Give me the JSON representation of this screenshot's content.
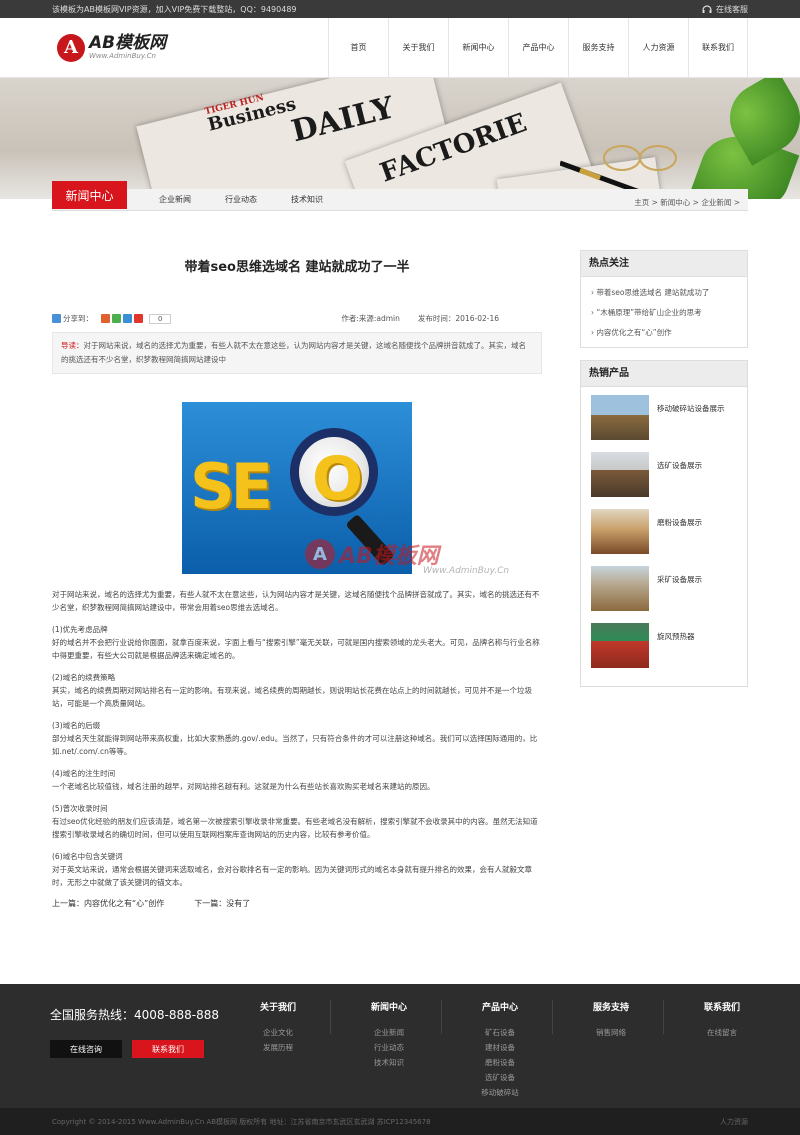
{
  "topbar": {
    "notice": "该模板为AB模板网VIP资源，加入VIP免费下载整站，QQ：9490489",
    "service": "在线客服"
  },
  "header": {
    "logo_letter": "A",
    "logo_brand": "AB模板网",
    "logo_url": "Www.AdminBuy.Cn",
    "nav": [
      "首页",
      "关于我们",
      "新闻中心",
      "产品中心",
      "服务支持",
      "人力资源",
      "联系我们"
    ]
  },
  "banner": {
    "headline_1": "Business",
    "headline_2": "DAILY",
    "headline_3": "FACTORIE",
    "headline_4": "TIGER HUN"
  },
  "subnav": {
    "title": "新闻中心",
    "links": [
      "企业新闻",
      "行业动态",
      "技术知识"
    ],
    "breadcrumb": "主页 > 新闻中心 > 企业新闻 >"
  },
  "article": {
    "title": "带着seo思维选域名 建站就成功了一半",
    "share_label": "分享到：",
    "share_count": "0",
    "author": "作者:来源:admin",
    "date": "发布时间：2016-02-16",
    "summary_label": "导读：",
    "summary": "对于网站来说，域名的选择尤为重要，有些人就不太在意这些，认为网站内容才是关键，这域名随便找个品牌拼音就成了。其实，域名的挑选还有不少名堂，织梦教程网简搞网站建设中",
    "image_letters": "SE",
    "image_letter_o": "O",
    "paragraphs": [
      {
        "h": "",
        "t": "对于网站来说，域名的选择尤为重要，有些人就不太在意这些，认为网站内容才是关键，这域名随便找个品牌拼音就成了。其实，域名的挑选还有不少名堂，织梦教程网简搞网站建设中，带常会用着seo思维去选域名。"
      },
      {
        "h": "(1)优先考虑品牌",
        "t": "好的域名并不会把行业说给你面面，就拿百度来说，字面上看与“搜索引擎”毫无关联，可就是国内搜索领域的龙头老大。可见，品牌名称与行业名称中得更重要，有些大公司就是根据品牌选来确定域名的。"
      },
      {
        "h": "(2)域名的续费策略",
        "t": "其实，域名的续费周期对网站排名有一定的影响。有现来说，域名续费的周期越长，则说明站长花费在站点上的时间就越长，可见并不是一个垃圾站，可能是一个高质量网站。"
      },
      {
        "h": "(3)域名的后缀",
        "t": "部分域名天生就能得到网站带来高权重，比如大家熟悉的.gov/.edu。当然了，只有符合条件的才可以注册这种域名。我们可以选择国际通用的，比如.net/.com/.cn等等。"
      },
      {
        "h": "(4)域名的注生时间",
        "t": "一个老域名比较值钱，域名注册的越早，对网站排名越有利。这就是为什么有些站长喜欢购买老域名来建站的原因。"
      },
      {
        "h": "(5)曾次收录时间",
        "t": "有过seo优化经验的朋友们应该清楚，域名第一次被搜索引擎收录非常重要。有些老域名没有解析，搜索引擎就不会收录其中的内容。虽然无法知道搜索引擎收录域名的确切时间，但可以使用互联网档案库查询网站的历史内容，比较有参考价值。"
      },
      {
        "h": "(6)域名中包含关键词",
        "t": "对于英文站来说，通常会根据关键词来选取域名，会对谷歌排名有一定的影响。因为关键词形式的域名本身就有提升排名的效果，会有人就毅文章时，无形之中就做了该关键词的锚文本。"
      }
    ],
    "prev": "上一篇：内容优化之有“心”创作",
    "next": "下一篇：没有了"
  },
  "watermark": {
    "letter": "A",
    "text": "AB模板网",
    "url": "Www.AdminBuy.Cn"
  },
  "sidebar": {
    "hot_title": "热点关注",
    "hot_items": [
      "带着seo思维选域名 建站就成功了",
      "“木桶原理”带给矿山企业的思考",
      "内容优化之有“心”创作"
    ],
    "prod_title": "热销产品",
    "products": [
      "移动破碎站设备展示",
      "选矿设备展示",
      "磨粉设备展示",
      "采矿设备展示",
      "旋风预热器"
    ]
  },
  "footer": {
    "hotline": "全国服务热线：4008-888-888",
    "btn_online": "在线咨询",
    "btn_contact": "联系我们",
    "cols": [
      {
        "title": "关于我们",
        "links": [
          "企业文化",
          "发展历程"
        ]
      },
      {
        "title": "新闻中心",
        "links": [
          "企业新闻",
          "行业动态",
          "技术知识"
        ]
      },
      {
        "title": "产品中心",
        "links": [
          "矿石设备",
          "建材设备",
          "磨粉设备",
          "选矿设备",
          "移动破碎站"
        ]
      },
      {
        "title": "服务支持",
        "links": [
          "销售网络"
        ]
      },
      {
        "title": "联系我们",
        "links": [
          "在线留言"
        ]
      }
    ],
    "copyright": "Copyright © 2014-2015 Www.AdminBuy.Cn AB模板网 版权所有   地址：江苏省南京市玄武区玄武湖   苏ICP12345678",
    "right_link": "人力资源"
  }
}
